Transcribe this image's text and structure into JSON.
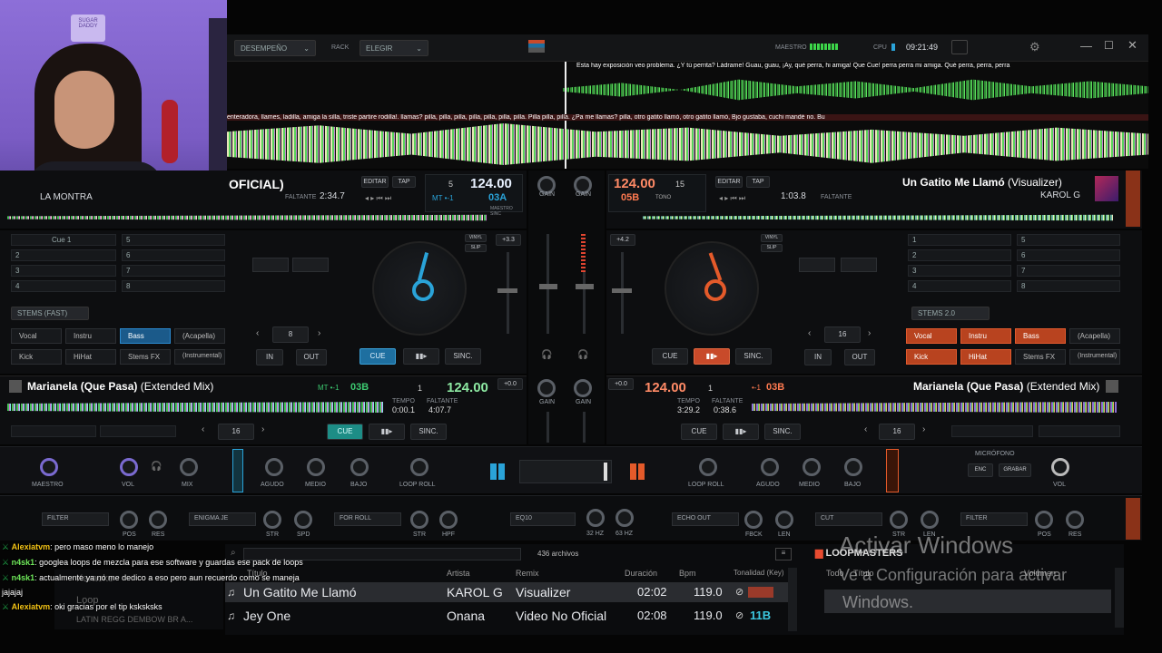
{
  "topbar": {
    "layout_label": "DESEMPEÑO",
    "rack_label": "RACK",
    "rack_value": "ELEGIR",
    "master_label": "MAESTRO",
    "cpu_label": "CPU",
    "clock": "09:21:49"
  },
  "lyrics": {
    "top": "Esta hay exposición veo problema. ¿Y     tú perrita? Ládrame! Guau,   guau, ¡Ay,   qué perra, hi amiga!  Que  Cue!  perra perra mi amiga. Qué perra, perra, perra",
    "bottom": "enteradora, llames, ladilla, amiga la silla, triste partire rodilla!. llamas? pilla, pilla,   pilla, pilla, pilla, pilla, pilla.  Pilla pilla, pilla.    ¿Pa me llamas? pilla, otro gatito llamó, otro gatito llamó, Bjo gustaba, cuchi mandé no. Bu"
  },
  "deck_left_top": {
    "title": "OFICIAL)",
    "artist": "LA MONTRA",
    "remaining_label": "FALTANTE",
    "remaining": "2:34.7",
    "edit_label": "EDITAR",
    "tap_label": "TAP",
    "beat_num": "5",
    "bpm": "124.00",
    "key": "03A",
    "key_prefix": "MT  •-1",
    "master_sync": "MAESTRO SINC"
  },
  "deck_right_top": {
    "bpm": "124.00",
    "beat_num": "15",
    "key": "05B",
    "key_suffix": "TONO",
    "edit_label": "EDITAR",
    "tap_label": "TAP",
    "elapsed": "1:03.8",
    "remaining_label": "FALTANTE",
    "title": "Un Gatito Me Llamó",
    "title_suffix": "(Visualizer)",
    "artist": "KAROL G"
  },
  "cues_left": [
    "Cue 1",
    "2",
    "3",
    "4",
    "5",
    "6",
    "7",
    "8"
  ],
  "cues_right": [
    "1",
    "2",
    "3",
    "4",
    "5",
    "6",
    "7",
    "8"
  ],
  "pitch_left": "+3.3",
  "pitch_right": "+4.2",
  "gain_label": "GAIN",
  "stems_left": {
    "mode": "STEMS (FAST)",
    "buttons": [
      "Vocal",
      "Instru",
      "Bass",
      "(Acapella)",
      "Kick",
      "HiHat",
      "Stems FX",
      "(Instrumental)"
    ]
  },
  "stems_right": {
    "mode": "STEMS 2.0",
    "buttons": [
      "Vocal",
      "Instru",
      "Bass",
      "(Acapella)",
      "Kick",
      "HiHat",
      "Stems FX",
      "(Instrumental)"
    ]
  },
  "loop_left": "8",
  "loop_right": "16",
  "transport": {
    "cue": "CUE",
    "sync": "SINC.",
    "in": "IN",
    "out": "OUT",
    "vinyl": "VINYL",
    "slip": "SLIP"
  },
  "deck_left_bottom": {
    "title": "Marianela (Que Pasa)",
    "title_suffix": "(Extended Mix)",
    "key": "03B",
    "key_prefix": "MT  •-1",
    "beat_num": "1",
    "bpm": "124.00",
    "tempo_label": "TEMPO",
    "tempo": "0:00.1",
    "remaining_label": "FALTANTE",
    "remaining": "4:07.7",
    "loop": "16"
  },
  "deck_right_bottom": {
    "bpm": "124.00",
    "beat_num": "1",
    "tempo_label": "TEMPO",
    "tempo": "3:29.2",
    "remaining_label": "FALTANTE",
    "remaining": "0:38.6",
    "key": "03B",
    "key_prefix": "•-1",
    "title": "Marianela (Que Pasa)",
    "title_suffix": "(Extended Mix)",
    "loop": "16"
  },
  "pitch_bl": "+0.0",
  "pitch_br": "+0.0",
  "mixer_left": [
    "MAESTRO",
    "VOL",
    "MIX",
    "AGUDO",
    "MEDIO",
    "BAJO",
    "LOOP ROLL"
  ],
  "mixer_right": [
    "LOOP ROLL",
    "AGUDO",
    "MEDIO",
    "BAJO",
    "VOL"
  ],
  "mic": {
    "label": "MICRÓFONO",
    "enc": "ENC",
    "rec": "GRABAR"
  },
  "fx_row": {
    "filter_l": "FILTER",
    "pos": "POS",
    "res": "RES",
    "enigma": "ENIGMA JE",
    "str": "STR",
    "spd": "SPD",
    "for_roll": "FOR ROLL",
    "hpf": "HPF",
    "eq10": "EQ10",
    "hz32": "32 Hz",
    "hz63": "63 Hz",
    "echo_out": "ECHO OUT",
    "fbck": "FBCK",
    "len": "LEN",
    "cut": "CUT",
    "filter_r": "FILTER"
  },
  "browser": {
    "file_count": "436 archivos",
    "columns": [
      "Título",
      "Artista",
      "Remix",
      "Duración",
      "Bpm",
      "Tonalidad (Key)"
    ],
    "rows": [
      {
        "title": "Un Gatito Me Llamó",
        "artist": "KAROL G",
        "remix": "Visualizer",
        "duration": "02:02",
        "bpm": "119.0",
        "key": ""
      },
      {
        "title": "Jey One",
        "artist": "Onana",
        "remix": "Video No Oficial",
        "duration": "02:08",
        "bpm": "119.0",
        "key": "11B"
      }
    ],
    "folders": [
      "Karaoke",
      "Loop",
      "LATIN REGG DEMBOW BR A..."
    ],
    "side_title": "LOOPMASTERS",
    "side_col1": "Todo",
    "side_col2": "Título",
    "side_col3": "Volumen"
  },
  "chat": [
    {
      "user": "Alexiatvm",
      "user_color": "#f3c316",
      "text": ": pero maso meno lo manejo"
    },
    {
      "user": "n4sk1",
      "user_color": "#6fe85a",
      "text": ": googlea loops de mezcla para ese software y guardas ese pack de loops"
    },
    {
      "user": "n4sk1",
      "user_color": "#6fe85a",
      "text": ": actualmente ya no me dedico a eso pero aun recuerdo como se maneja"
    },
    {
      "user": "",
      "user_color": "#fff",
      "text": "jajajaj"
    },
    {
      "user": "Alexiatvm",
      "user_color": "#f3c316",
      "text": ": oki gracias por el tip ksksksks"
    }
  ],
  "webcam_sign": "SUGAR DADDY",
  "watermark": {
    "title": "Activar Windows",
    "subtitle": "Ve a Configuración para activar",
    "subtitle2": "Windows."
  },
  "colors": {
    "left_accent": "#2aa3d8",
    "right_accent": "#e45a2a",
    "wave_green": "#58d45a"
  }
}
